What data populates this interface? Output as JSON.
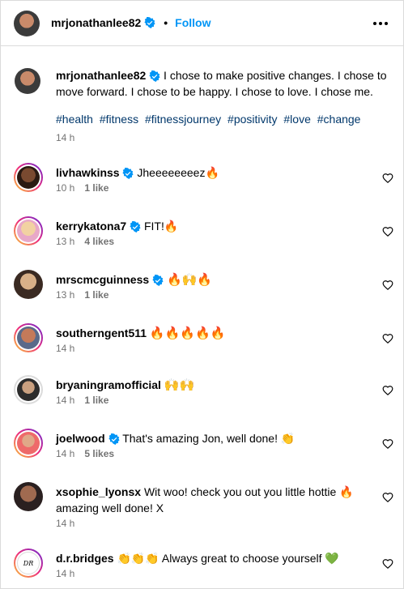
{
  "header": {
    "username": "mrjonathanlee82",
    "follow_label": "Follow",
    "more_icon": "more-horizontal-icon"
  },
  "caption": {
    "username": "mrjonathanlee82",
    "text": "I chose to make positive changes. I chose to move forward. I chose to be happy. I chose to love. I chose me.",
    "hashtags": [
      "#health",
      "#fitness",
      "#fitnessjourney",
      "#positivity",
      "#love",
      "#change"
    ],
    "time": "14 h"
  },
  "colors": {
    "link": "#0095f6",
    "hashtag": "#00376b",
    "verified": "#0095f6",
    "meta": "#737373",
    "border": "#dbdbdb"
  },
  "comments": [
    {
      "username": "livhawkinss",
      "verified": true,
      "text": "Jheeeeeeeez🔥",
      "time": "10 h",
      "likes": "1 like"
    },
    {
      "username": "kerrykatona7",
      "verified": true,
      "text": "FIT!🔥",
      "time": "13 h",
      "likes": "4 likes"
    },
    {
      "username": "mrscmcguinness",
      "verified": true,
      "text": "🔥🙌🔥",
      "time": "13 h",
      "likes": "1 like"
    },
    {
      "username": "southerngent511",
      "verified": false,
      "text": "🔥🔥🔥🔥🔥",
      "time": "14 h",
      "likes": ""
    },
    {
      "username": "bryaningramofficial",
      "verified": false,
      "text": "🙌🙌",
      "time": "14 h",
      "likes": "1 like"
    },
    {
      "username": "joelwood",
      "verified": true,
      "text": "That's amazing Jon, well done! 👏",
      "time": "14 h",
      "likes": "5 likes"
    },
    {
      "username": "xsophie_lyonsx",
      "verified": false,
      "text": "Wit woo! check you out you little hottie 🔥 amazing well done! X",
      "time": "14 h",
      "likes": ""
    },
    {
      "username": "d.r.bridges",
      "verified": false,
      "text": "👏👏👏 Always great to choose yourself 💚",
      "time": "14 h",
      "likes": ""
    }
  ]
}
